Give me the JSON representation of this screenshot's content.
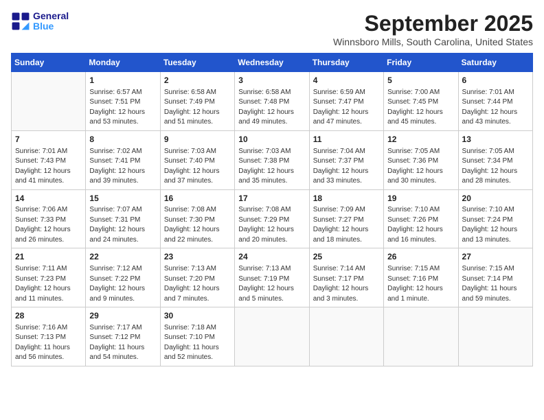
{
  "logo": {
    "line1": "General",
    "line2": "Blue"
  },
  "title": "September 2025",
  "location": "Winnsboro Mills, South Carolina, United States",
  "days_of_week": [
    "Sunday",
    "Monday",
    "Tuesday",
    "Wednesday",
    "Thursday",
    "Friday",
    "Saturday"
  ],
  "weeks": [
    [
      {
        "day": "",
        "info": ""
      },
      {
        "day": "1",
        "info": "Sunrise: 6:57 AM\nSunset: 7:51 PM\nDaylight: 12 hours\nand 53 minutes."
      },
      {
        "day": "2",
        "info": "Sunrise: 6:58 AM\nSunset: 7:49 PM\nDaylight: 12 hours\nand 51 minutes."
      },
      {
        "day": "3",
        "info": "Sunrise: 6:58 AM\nSunset: 7:48 PM\nDaylight: 12 hours\nand 49 minutes."
      },
      {
        "day": "4",
        "info": "Sunrise: 6:59 AM\nSunset: 7:47 PM\nDaylight: 12 hours\nand 47 minutes."
      },
      {
        "day": "5",
        "info": "Sunrise: 7:00 AM\nSunset: 7:45 PM\nDaylight: 12 hours\nand 45 minutes."
      },
      {
        "day": "6",
        "info": "Sunrise: 7:01 AM\nSunset: 7:44 PM\nDaylight: 12 hours\nand 43 minutes."
      }
    ],
    [
      {
        "day": "7",
        "info": "Sunrise: 7:01 AM\nSunset: 7:43 PM\nDaylight: 12 hours\nand 41 minutes."
      },
      {
        "day": "8",
        "info": "Sunrise: 7:02 AM\nSunset: 7:41 PM\nDaylight: 12 hours\nand 39 minutes."
      },
      {
        "day": "9",
        "info": "Sunrise: 7:03 AM\nSunset: 7:40 PM\nDaylight: 12 hours\nand 37 minutes."
      },
      {
        "day": "10",
        "info": "Sunrise: 7:03 AM\nSunset: 7:38 PM\nDaylight: 12 hours\nand 35 minutes."
      },
      {
        "day": "11",
        "info": "Sunrise: 7:04 AM\nSunset: 7:37 PM\nDaylight: 12 hours\nand 33 minutes."
      },
      {
        "day": "12",
        "info": "Sunrise: 7:05 AM\nSunset: 7:36 PM\nDaylight: 12 hours\nand 30 minutes."
      },
      {
        "day": "13",
        "info": "Sunrise: 7:05 AM\nSunset: 7:34 PM\nDaylight: 12 hours\nand 28 minutes."
      }
    ],
    [
      {
        "day": "14",
        "info": "Sunrise: 7:06 AM\nSunset: 7:33 PM\nDaylight: 12 hours\nand 26 minutes."
      },
      {
        "day": "15",
        "info": "Sunrise: 7:07 AM\nSunset: 7:31 PM\nDaylight: 12 hours\nand 24 minutes."
      },
      {
        "day": "16",
        "info": "Sunrise: 7:08 AM\nSunset: 7:30 PM\nDaylight: 12 hours\nand 22 minutes."
      },
      {
        "day": "17",
        "info": "Sunrise: 7:08 AM\nSunset: 7:29 PM\nDaylight: 12 hours\nand 20 minutes."
      },
      {
        "day": "18",
        "info": "Sunrise: 7:09 AM\nSunset: 7:27 PM\nDaylight: 12 hours\nand 18 minutes."
      },
      {
        "day": "19",
        "info": "Sunrise: 7:10 AM\nSunset: 7:26 PM\nDaylight: 12 hours\nand 16 minutes."
      },
      {
        "day": "20",
        "info": "Sunrise: 7:10 AM\nSunset: 7:24 PM\nDaylight: 12 hours\nand 13 minutes."
      }
    ],
    [
      {
        "day": "21",
        "info": "Sunrise: 7:11 AM\nSunset: 7:23 PM\nDaylight: 12 hours\nand 11 minutes."
      },
      {
        "day": "22",
        "info": "Sunrise: 7:12 AM\nSunset: 7:22 PM\nDaylight: 12 hours\nand 9 minutes."
      },
      {
        "day": "23",
        "info": "Sunrise: 7:13 AM\nSunset: 7:20 PM\nDaylight: 12 hours\nand 7 minutes."
      },
      {
        "day": "24",
        "info": "Sunrise: 7:13 AM\nSunset: 7:19 PM\nDaylight: 12 hours\nand 5 minutes."
      },
      {
        "day": "25",
        "info": "Sunrise: 7:14 AM\nSunset: 7:17 PM\nDaylight: 12 hours\nand 3 minutes."
      },
      {
        "day": "26",
        "info": "Sunrise: 7:15 AM\nSunset: 7:16 PM\nDaylight: 12 hours\nand 1 minute."
      },
      {
        "day": "27",
        "info": "Sunrise: 7:15 AM\nSunset: 7:14 PM\nDaylight: 11 hours\nand 59 minutes."
      }
    ],
    [
      {
        "day": "28",
        "info": "Sunrise: 7:16 AM\nSunset: 7:13 PM\nDaylight: 11 hours\nand 56 minutes."
      },
      {
        "day": "29",
        "info": "Sunrise: 7:17 AM\nSunset: 7:12 PM\nDaylight: 11 hours\nand 54 minutes."
      },
      {
        "day": "30",
        "info": "Sunrise: 7:18 AM\nSunset: 7:10 PM\nDaylight: 11 hours\nand 52 minutes."
      },
      {
        "day": "",
        "info": ""
      },
      {
        "day": "",
        "info": ""
      },
      {
        "day": "",
        "info": ""
      },
      {
        "day": "",
        "info": ""
      }
    ]
  ]
}
